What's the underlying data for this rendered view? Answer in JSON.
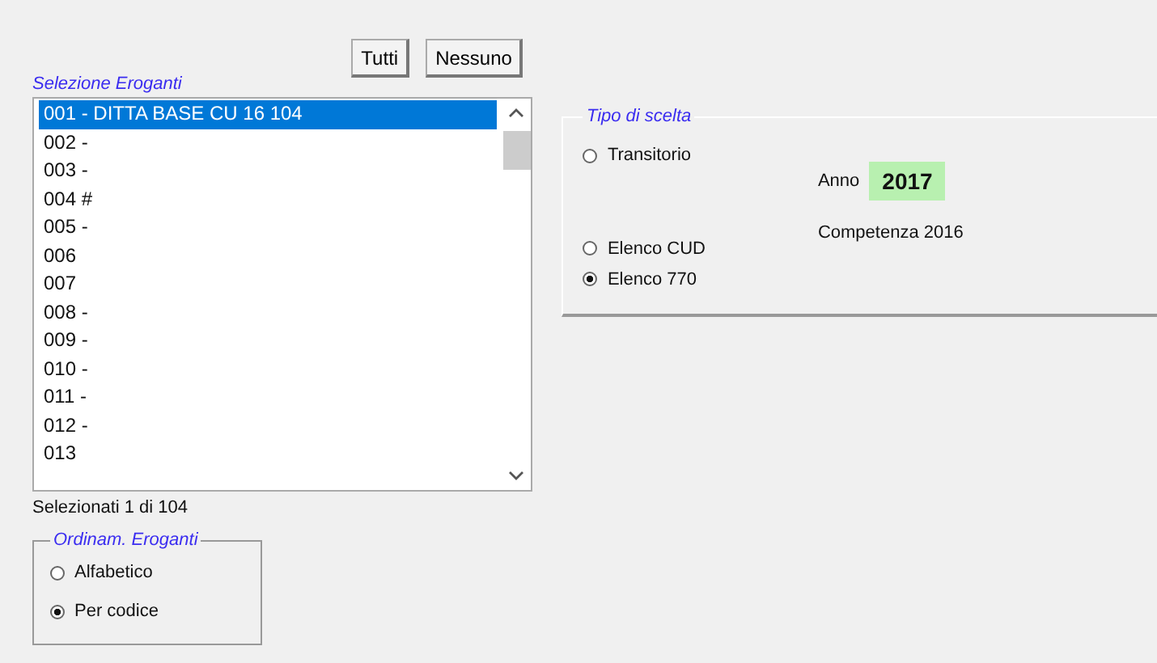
{
  "selection": {
    "label": "Selezione Eroganti",
    "buttons": [
      "Tutti",
      "Nessuno"
    ],
    "items": [
      {
        "text": "001 - DITTA BASE CU 16 104",
        "selected": true
      },
      {
        "text": "002 -",
        "selected": false
      },
      {
        "text": "003 -",
        "selected": false
      },
      {
        "text": "004 #",
        "selected": false
      },
      {
        "text": "005 -",
        "selected": false
      },
      {
        "text": "006",
        "selected": false
      },
      {
        "text": "007",
        "selected": false
      },
      {
        "text": "008 -",
        "selected": false
      },
      {
        "text": "009 -",
        "selected": false
      },
      {
        "text": "010 -",
        "selected": false
      },
      {
        "text": "011 -",
        "selected": false
      },
      {
        "text": "012 -",
        "selected": false
      },
      {
        "text": "013",
        "selected": false
      }
    ],
    "status": "Selezionati 1 di 104"
  },
  "ordering": {
    "title": "Ordinam. Eroganti",
    "options": [
      {
        "label": "Alfabetico",
        "selected": false
      },
      {
        "label": "Per codice",
        "selected": true
      }
    ]
  },
  "choice": {
    "title": "Tipo di scelta",
    "options": [
      {
        "label": "Transitorio",
        "selected": false
      },
      {
        "label": "Elenco CUD",
        "selected": false
      },
      {
        "label": "Elenco 770",
        "selected": true
      }
    ],
    "year_label": "Anno",
    "year": "2017",
    "competence": "Competenza 2016"
  }
}
